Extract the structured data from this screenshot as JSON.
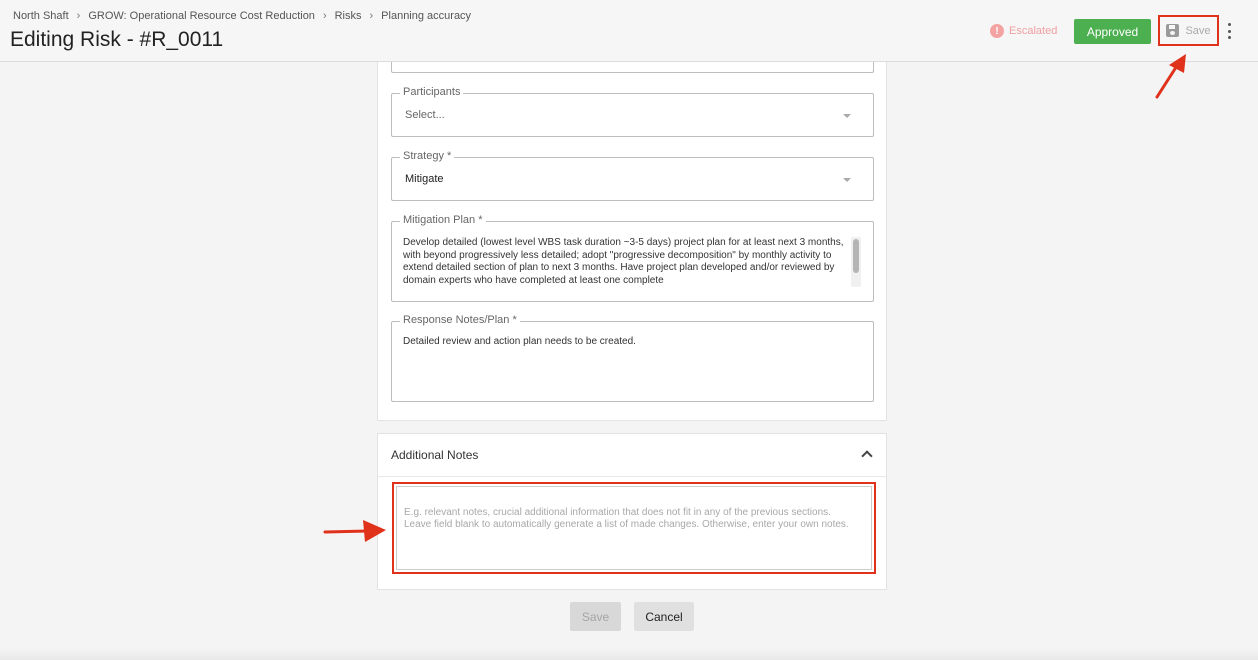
{
  "breadcrumb": [
    "North Shaft",
    "GROW: Operational Resource Cost Reduction",
    "Risks",
    "Planning accuracy"
  ],
  "breadcrumb_separator": "›",
  "page_title": "Editing Risk - #R_0011",
  "header": {
    "escalated_label": "Escalated",
    "escalated_icon": "!",
    "approved_label": "Approved",
    "save_label": "Save"
  },
  "form": {
    "participants": {
      "label": "Participants",
      "placeholder": "Select..."
    },
    "strategy": {
      "label": "Strategy *",
      "value": "Mitigate"
    },
    "mitigation_plan": {
      "label": "Mitigation Plan *",
      "value": "Develop detailed (lowest level WBS task duration ~3-5 days) project plan for at least next 3 months, with beyond progressively less detailed; adopt \"progressive decomposition\" by monthly activity to extend detailed section of plan to next 3 months.  Have project plan developed and/or reviewed by domain experts who have completed at least one complete"
    },
    "response_notes": {
      "label": "Response Notes/Plan *",
      "value": "Detailed review and action plan needs to be created."
    }
  },
  "additional_notes": {
    "title": "Additional Notes",
    "placeholder_line1": "E.g. relevant notes, crucial additional information that does not fit in any of the previous sections.",
    "placeholder_line2": "Leave field blank to automatically generate a list of made changes. Otherwise, enter your own notes."
  },
  "footer": {
    "save_label": "Save",
    "cancel_label": "Cancel"
  },
  "colors": {
    "approved": "#4caf50",
    "highlight": "#e0311b",
    "escalated": "#f4a3a3"
  }
}
